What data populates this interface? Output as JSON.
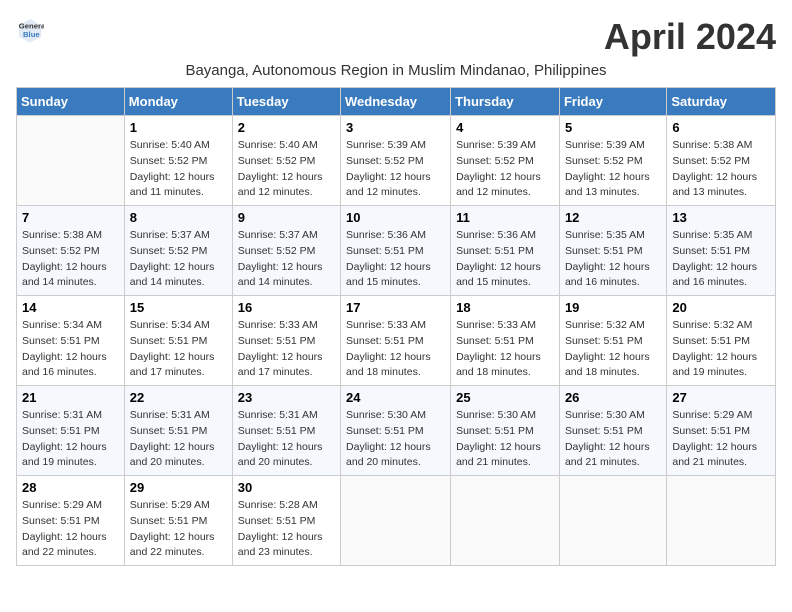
{
  "logo": {
    "general": "General",
    "blue": "Blue"
  },
  "title": "April 2024",
  "subtitle": "Bayanga, Autonomous Region in Muslim Mindanao, Philippines",
  "headers": [
    "Sunday",
    "Monday",
    "Tuesday",
    "Wednesday",
    "Thursday",
    "Friday",
    "Saturday"
  ],
  "weeks": [
    [
      {
        "day": "",
        "sunrise": "",
        "sunset": "",
        "daylight": ""
      },
      {
        "day": "1",
        "sunrise": "Sunrise: 5:40 AM",
        "sunset": "Sunset: 5:52 PM",
        "daylight": "Daylight: 12 hours and 11 minutes."
      },
      {
        "day": "2",
        "sunrise": "Sunrise: 5:40 AM",
        "sunset": "Sunset: 5:52 PM",
        "daylight": "Daylight: 12 hours and 12 minutes."
      },
      {
        "day": "3",
        "sunrise": "Sunrise: 5:39 AM",
        "sunset": "Sunset: 5:52 PM",
        "daylight": "Daylight: 12 hours and 12 minutes."
      },
      {
        "day": "4",
        "sunrise": "Sunrise: 5:39 AM",
        "sunset": "Sunset: 5:52 PM",
        "daylight": "Daylight: 12 hours and 12 minutes."
      },
      {
        "day": "5",
        "sunrise": "Sunrise: 5:39 AM",
        "sunset": "Sunset: 5:52 PM",
        "daylight": "Daylight: 12 hours and 13 minutes."
      },
      {
        "day": "6",
        "sunrise": "Sunrise: 5:38 AM",
        "sunset": "Sunset: 5:52 PM",
        "daylight": "Daylight: 12 hours and 13 minutes."
      }
    ],
    [
      {
        "day": "7",
        "sunrise": "Sunrise: 5:38 AM",
        "sunset": "Sunset: 5:52 PM",
        "daylight": "Daylight: 12 hours and 14 minutes."
      },
      {
        "day": "8",
        "sunrise": "Sunrise: 5:37 AM",
        "sunset": "Sunset: 5:52 PM",
        "daylight": "Daylight: 12 hours and 14 minutes."
      },
      {
        "day": "9",
        "sunrise": "Sunrise: 5:37 AM",
        "sunset": "Sunset: 5:52 PM",
        "daylight": "Daylight: 12 hours and 14 minutes."
      },
      {
        "day": "10",
        "sunrise": "Sunrise: 5:36 AM",
        "sunset": "Sunset: 5:51 PM",
        "daylight": "Daylight: 12 hours and 15 minutes."
      },
      {
        "day": "11",
        "sunrise": "Sunrise: 5:36 AM",
        "sunset": "Sunset: 5:51 PM",
        "daylight": "Daylight: 12 hours and 15 minutes."
      },
      {
        "day": "12",
        "sunrise": "Sunrise: 5:35 AM",
        "sunset": "Sunset: 5:51 PM",
        "daylight": "Daylight: 12 hours and 16 minutes."
      },
      {
        "day": "13",
        "sunrise": "Sunrise: 5:35 AM",
        "sunset": "Sunset: 5:51 PM",
        "daylight": "Daylight: 12 hours and 16 minutes."
      }
    ],
    [
      {
        "day": "14",
        "sunrise": "Sunrise: 5:34 AM",
        "sunset": "Sunset: 5:51 PM",
        "daylight": "Daylight: 12 hours and 16 minutes."
      },
      {
        "day": "15",
        "sunrise": "Sunrise: 5:34 AM",
        "sunset": "Sunset: 5:51 PM",
        "daylight": "Daylight: 12 hours and 17 minutes."
      },
      {
        "day": "16",
        "sunrise": "Sunrise: 5:33 AM",
        "sunset": "Sunset: 5:51 PM",
        "daylight": "Daylight: 12 hours and 17 minutes."
      },
      {
        "day": "17",
        "sunrise": "Sunrise: 5:33 AM",
        "sunset": "Sunset: 5:51 PM",
        "daylight": "Daylight: 12 hours and 18 minutes."
      },
      {
        "day": "18",
        "sunrise": "Sunrise: 5:33 AM",
        "sunset": "Sunset: 5:51 PM",
        "daylight": "Daylight: 12 hours and 18 minutes."
      },
      {
        "day": "19",
        "sunrise": "Sunrise: 5:32 AM",
        "sunset": "Sunset: 5:51 PM",
        "daylight": "Daylight: 12 hours and 18 minutes."
      },
      {
        "day": "20",
        "sunrise": "Sunrise: 5:32 AM",
        "sunset": "Sunset: 5:51 PM",
        "daylight": "Daylight: 12 hours and 19 minutes."
      }
    ],
    [
      {
        "day": "21",
        "sunrise": "Sunrise: 5:31 AM",
        "sunset": "Sunset: 5:51 PM",
        "daylight": "Daylight: 12 hours and 19 minutes."
      },
      {
        "day": "22",
        "sunrise": "Sunrise: 5:31 AM",
        "sunset": "Sunset: 5:51 PM",
        "daylight": "Daylight: 12 hours and 20 minutes."
      },
      {
        "day": "23",
        "sunrise": "Sunrise: 5:31 AM",
        "sunset": "Sunset: 5:51 PM",
        "daylight": "Daylight: 12 hours and 20 minutes."
      },
      {
        "day": "24",
        "sunrise": "Sunrise: 5:30 AM",
        "sunset": "Sunset: 5:51 PM",
        "daylight": "Daylight: 12 hours and 20 minutes."
      },
      {
        "day": "25",
        "sunrise": "Sunrise: 5:30 AM",
        "sunset": "Sunset: 5:51 PM",
        "daylight": "Daylight: 12 hours and 21 minutes."
      },
      {
        "day": "26",
        "sunrise": "Sunrise: 5:30 AM",
        "sunset": "Sunset: 5:51 PM",
        "daylight": "Daylight: 12 hours and 21 minutes."
      },
      {
        "day": "27",
        "sunrise": "Sunrise: 5:29 AM",
        "sunset": "Sunset: 5:51 PM",
        "daylight": "Daylight: 12 hours and 21 minutes."
      }
    ],
    [
      {
        "day": "28",
        "sunrise": "Sunrise: 5:29 AM",
        "sunset": "Sunset: 5:51 PM",
        "daylight": "Daylight: 12 hours and 22 minutes."
      },
      {
        "day": "29",
        "sunrise": "Sunrise: 5:29 AM",
        "sunset": "Sunset: 5:51 PM",
        "daylight": "Daylight: 12 hours and 22 minutes."
      },
      {
        "day": "30",
        "sunrise": "Sunrise: 5:28 AM",
        "sunset": "Sunset: 5:51 PM",
        "daylight": "Daylight: 12 hours and 23 minutes."
      },
      {
        "day": "",
        "sunrise": "",
        "sunset": "",
        "daylight": ""
      },
      {
        "day": "",
        "sunrise": "",
        "sunset": "",
        "daylight": ""
      },
      {
        "day": "",
        "sunrise": "",
        "sunset": "",
        "daylight": ""
      },
      {
        "day": "",
        "sunrise": "",
        "sunset": "",
        "daylight": ""
      }
    ]
  ]
}
